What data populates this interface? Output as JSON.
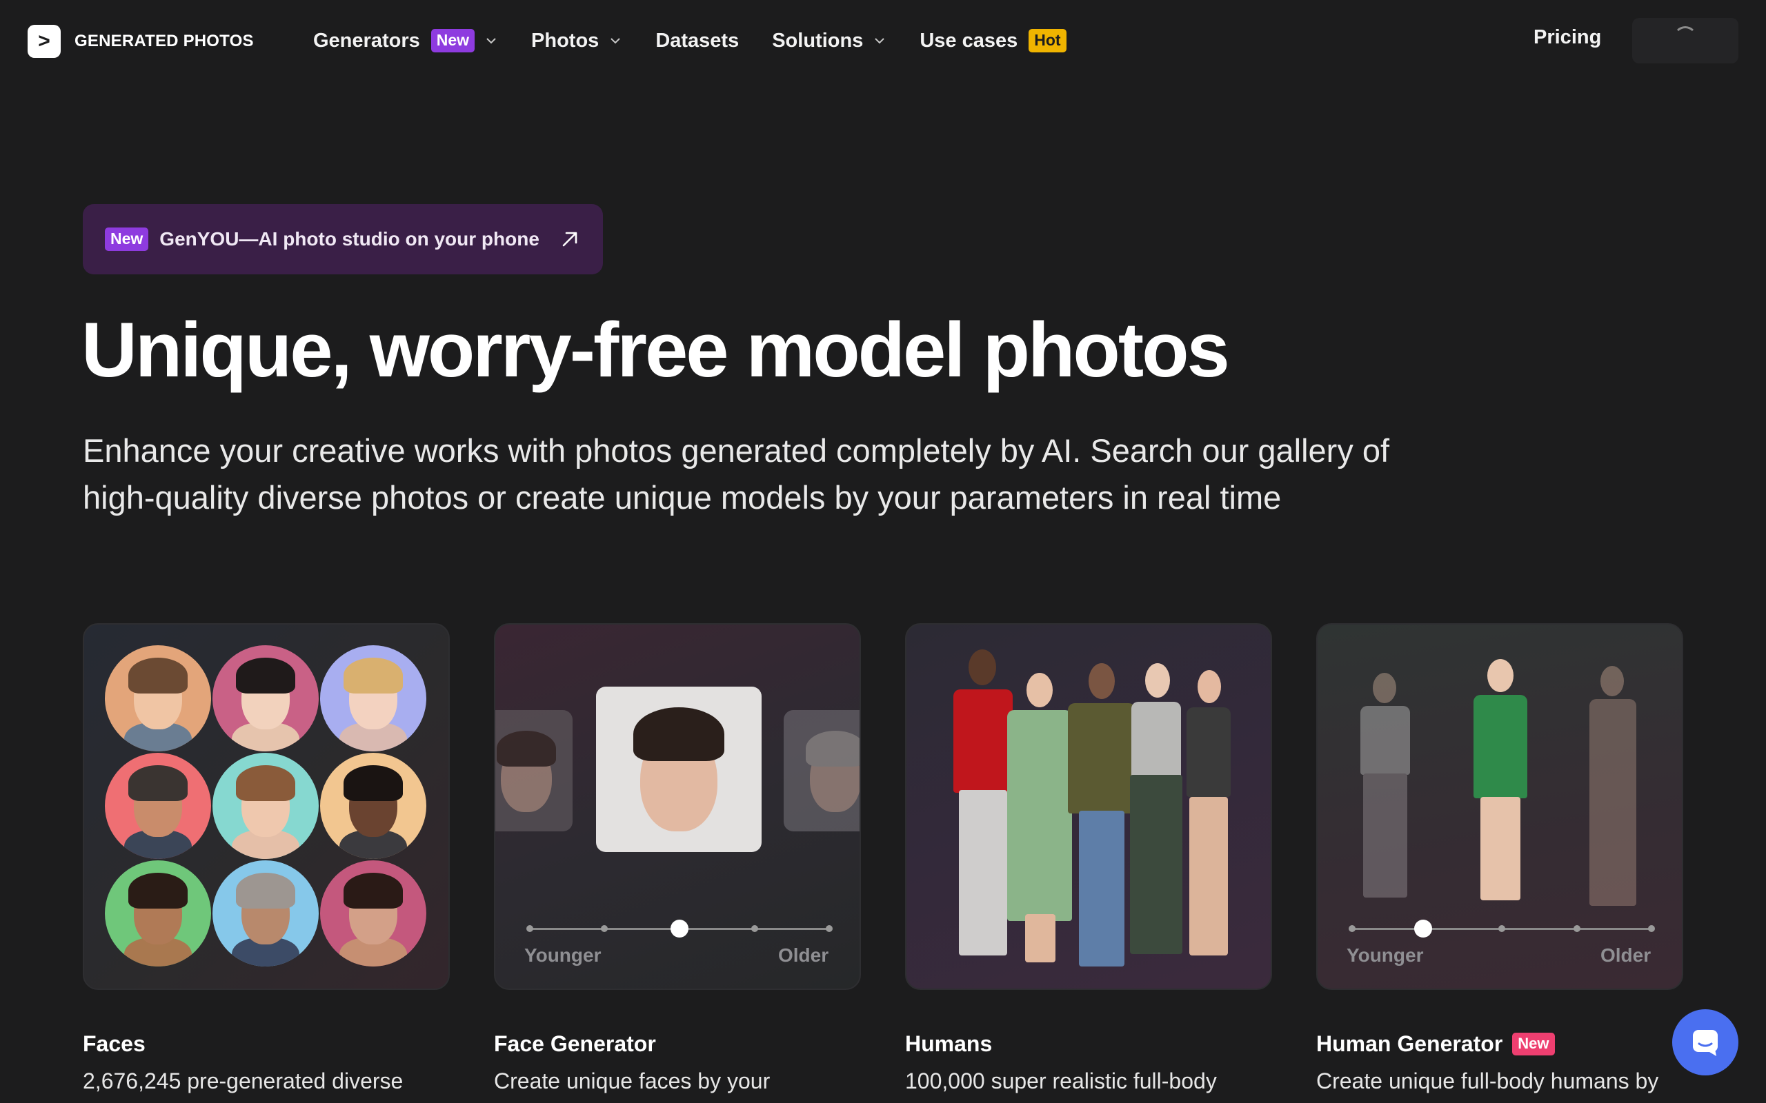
{
  "header": {
    "logo_glyph": ">",
    "logo_text": "GENERATED PHOTOS",
    "nav": [
      {
        "label": "Generators",
        "badge": "New",
        "has_dropdown": true
      },
      {
        "label": "Photos",
        "has_dropdown": true
      },
      {
        "label": "Datasets",
        "has_dropdown": false
      },
      {
        "label": "Solutions",
        "has_dropdown": true
      },
      {
        "label": "Use cases",
        "badge": "Hot",
        "has_dropdown": false
      }
    ],
    "pricing_label": "Pricing"
  },
  "promo": {
    "badge": "New",
    "text": "GenYOU—AI photo studio on your phone",
    "icon": "arrow-up-right-icon"
  },
  "hero": {
    "title": "Unique, worry-free model photos",
    "subtitle_line1": "Enhance your creative works with photos generated completely by AI. Search our gallery of",
    "subtitle_line2": "high-quality diverse photos or create unique models by your parameters in real time"
  },
  "cards": [
    {
      "title": "Faces",
      "desc": "2,676,245 pre-generated diverse"
    },
    {
      "title": "Face Generator",
      "desc": "Create unique faces by your",
      "slider": {
        "left": "Younger",
        "right": "Older",
        "position": 0.5
      }
    },
    {
      "title": "Humans",
      "desc": "100,000 super realistic full-body"
    },
    {
      "title": "Human Generator",
      "badge": "New",
      "desc": "Create unique full-body humans by",
      "slider": {
        "left": "Younger",
        "right": "Older",
        "position": 0.25
      }
    }
  ],
  "colors": {
    "background": "#1c1c1d",
    "badge_new": "#8e3bdf",
    "badge_hot": "#f0b400",
    "badge_new_pink": "#ee3f70",
    "chat_button": "#4a6ff0"
  }
}
